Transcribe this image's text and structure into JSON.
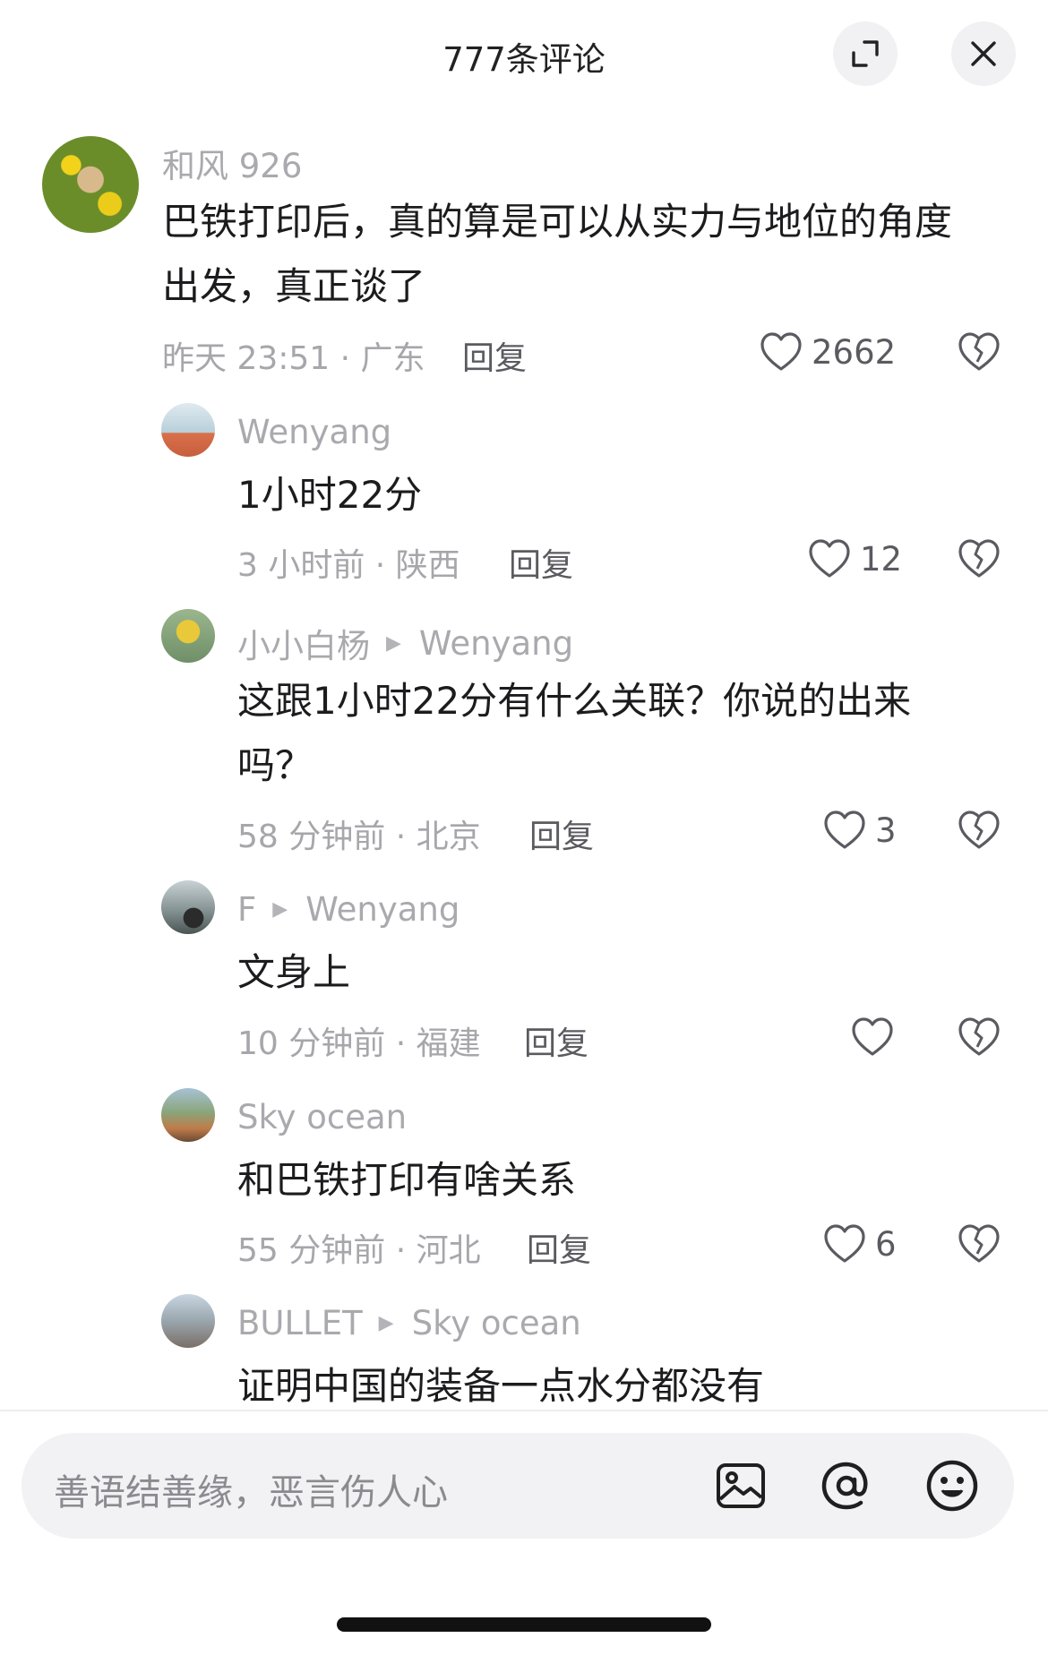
{
  "header": {
    "title": "777条评论",
    "expand_icon": "expand-icon",
    "close_icon": "close-icon"
  },
  "comments": [
    {
      "user": "和风 926",
      "text_lines": [
        "巴铁打印后，真的算是可以从实力与地位的角度",
        "出发，真正谈了"
      ],
      "meta": "昨天 23:51 · 广东",
      "reply": "回复",
      "likes": "2662"
    },
    {
      "user": "Wenyang",
      "text_lines": [
        "1小时22分"
      ],
      "meta": "3 小时前 · 陕西",
      "reply": "回复",
      "likes": "12"
    },
    {
      "user": "小小白杨",
      "reply_to": "Wenyang",
      "text_lines": [
        "这跟1小时22分有什么关联？你说的出来",
        "吗？"
      ],
      "meta": "58 分钟前 · 北京",
      "reply": "回复",
      "likes": "3"
    },
    {
      "user": "F",
      "reply_to": "Wenyang",
      "text_lines": [
        "文身上"
      ],
      "meta": "10 分钟前 · 福建",
      "reply": "回复",
      "likes": ""
    },
    {
      "user": "Sky ocean",
      "text_lines": [
        "和巴铁打印有啥关系"
      ],
      "meta": "55 分钟前 · 河北",
      "reply": "回复",
      "likes": "6"
    },
    {
      "user": "BULLET",
      "reply_to": "Sky ocean",
      "text_lines": [
        "证明中国的装备一点水分都没有"
      ]
    }
  ],
  "input": {
    "placeholder": "善语结善缘，恶言伤人心",
    "icons": [
      "image-icon",
      "at-icon",
      "emoji-icon"
    ]
  },
  "colors": {
    "background": "#ffffff",
    "text": "#1c1c1e",
    "muted": "#a6a6ab",
    "input_bg": "#f2f2f4"
  }
}
